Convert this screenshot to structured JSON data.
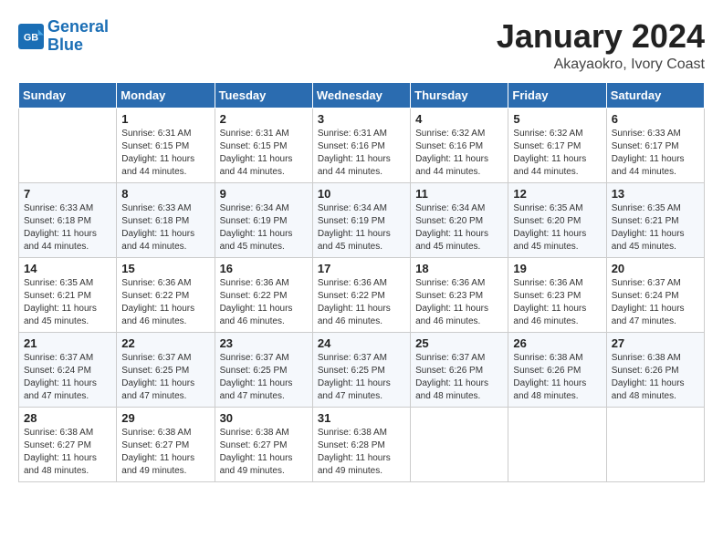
{
  "header": {
    "logo_line1": "General",
    "logo_line2": "Blue",
    "title": "January 2024",
    "subtitle": "Akayaokro, Ivory Coast"
  },
  "days_of_week": [
    "Sunday",
    "Monday",
    "Tuesday",
    "Wednesday",
    "Thursday",
    "Friday",
    "Saturday"
  ],
  "weeks": [
    [
      {
        "day": "",
        "info": ""
      },
      {
        "day": "1",
        "info": "Sunrise: 6:31 AM\nSunset: 6:15 PM\nDaylight: 11 hours\nand 44 minutes."
      },
      {
        "day": "2",
        "info": "Sunrise: 6:31 AM\nSunset: 6:15 PM\nDaylight: 11 hours\nand 44 minutes."
      },
      {
        "day": "3",
        "info": "Sunrise: 6:31 AM\nSunset: 6:16 PM\nDaylight: 11 hours\nand 44 minutes."
      },
      {
        "day": "4",
        "info": "Sunrise: 6:32 AM\nSunset: 6:16 PM\nDaylight: 11 hours\nand 44 minutes."
      },
      {
        "day": "5",
        "info": "Sunrise: 6:32 AM\nSunset: 6:17 PM\nDaylight: 11 hours\nand 44 minutes."
      },
      {
        "day": "6",
        "info": "Sunrise: 6:33 AM\nSunset: 6:17 PM\nDaylight: 11 hours\nand 44 minutes."
      }
    ],
    [
      {
        "day": "7",
        "info": "Sunrise: 6:33 AM\nSunset: 6:18 PM\nDaylight: 11 hours\nand 44 minutes."
      },
      {
        "day": "8",
        "info": "Sunrise: 6:33 AM\nSunset: 6:18 PM\nDaylight: 11 hours\nand 44 minutes."
      },
      {
        "day": "9",
        "info": "Sunrise: 6:34 AM\nSunset: 6:19 PM\nDaylight: 11 hours\nand 45 minutes."
      },
      {
        "day": "10",
        "info": "Sunrise: 6:34 AM\nSunset: 6:19 PM\nDaylight: 11 hours\nand 45 minutes."
      },
      {
        "day": "11",
        "info": "Sunrise: 6:34 AM\nSunset: 6:20 PM\nDaylight: 11 hours\nand 45 minutes."
      },
      {
        "day": "12",
        "info": "Sunrise: 6:35 AM\nSunset: 6:20 PM\nDaylight: 11 hours\nand 45 minutes."
      },
      {
        "day": "13",
        "info": "Sunrise: 6:35 AM\nSunset: 6:21 PM\nDaylight: 11 hours\nand 45 minutes."
      }
    ],
    [
      {
        "day": "14",
        "info": "Sunrise: 6:35 AM\nSunset: 6:21 PM\nDaylight: 11 hours\nand 45 minutes."
      },
      {
        "day": "15",
        "info": "Sunrise: 6:36 AM\nSunset: 6:22 PM\nDaylight: 11 hours\nand 46 minutes."
      },
      {
        "day": "16",
        "info": "Sunrise: 6:36 AM\nSunset: 6:22 PM\nDaylight: 11 hours\nand 46 minutes."
      },
      {
        "day": "17",
        "info": "Sunrise: 6:36 AM\nSunset: 6:22 PM\nDaylight: 11 hours\nand 46 minutes."
      },
      {
        "day": "18",
        "info": "Sunrise: 6:36 AM\nSunset: 6:23 PM\nDaylight: 11 hours\nand 46 minutes."
      },
      {
        "day": "19",
        "info": "Sunrise: 6:36 AM\nSunset: 6:23 PM\nDaylight: 11 hours\nand 46 minutes."
      },
      {
        "day": "20",
        "info": "Sunrise: 6:37 AM\nSunset: 6:24 PM\nDaylight: 11 hours\nand 47 minutes."
      }
    ],
    [
      {
        "day": "21",
        "info": "Sunrise: 6:37 AM\nSunset: 6:24 PM\nDaylight: 11 hours\nand 47 minutes."
      },
      {
        "day": "22",
        "info": "Sunrise: 6:37 AM\nSunset: 6:25 PM\nDaylight: 11 hours\nand 47 minutes."
      },
      {
        "day": "23",
        "info": "Sunrise: 6:37 AM\nSunset: 6:25 PM\nDaylight: 11 hours\nand 47 minutes."
      },
      {
        "day": "24",
        "info": "Sunrise: 6:37 AM\nSunset: 6:25 PM\nDaylight: 11 hours\nand 47 minutes."
      },
      {
        "day": "25",
        "info": "Sunrise: 6:37 AM\nSunset: 6:26 PM\nDaylight: 11 hours\nand 48 minutes."
      },
      {
        "day": "26",
        "info": "Sunrise: 6:38 AM\nSunset: 6:26 PM\nDaylight: 11 hours\nand 48 minutes."
      },
      {
        "day": "27",
        "info": "Sunrise: 6:38 AM\nSunset: 6:26 PM\nDaylight: 11 hours\nand 48 minutes."
      }
    ],
    [
      {
        "day": "28",
        "info": "Sunrise: 6:38 AM\nSunset: 6:27 PM\nDaylight: 11 hours\nand 48 minutes."
      },
      {
        "day": "29",
        "info": "Sunrise: 6:38 AM\nSunset: 6:27 PM\nDaylight: 11 hours\nand 49 minutes."
      },
      {
        "day": "30",
        "info": "Sunrise: 6:38 AM\nSunset: 6:27 PM\nDaylight: 11 hours\nand 49 minutes."
      },
      {
        "day": "31",
        "info": "Sunrise: 6:38 AM\nSunset: 6:28 PM\nDaylight: 11 hours\nand 49 minutes."
      },
      {
        "day": "",
        "info": ""
      },
      {
        "day": "",
        "info": ""
      },
      {
        "day": "",
        "info": ""
      }
    ]
  ]
}
